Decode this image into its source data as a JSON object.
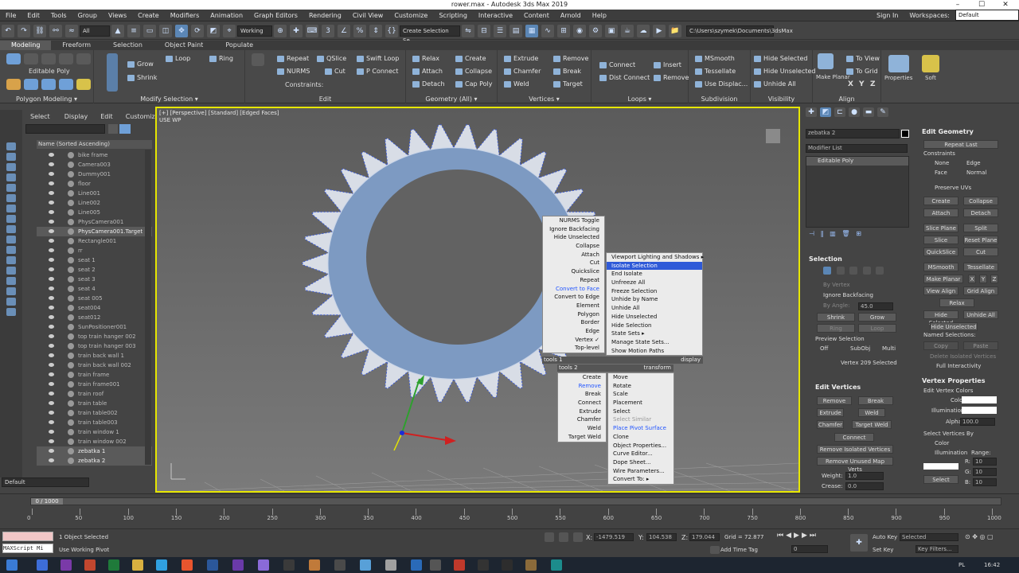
{
  "window": {
    "title": "rower.max - Autodesk 3ds Max 2019"
  },
  "menubar": [
    "File",
    "Edit",
    "Tools",
    "Group",
    "Views",
    "Create",
    "Modifiers",
    "Animation",
    "Graph Editors",
    "Rendering",
    "Civil View",
    "Customize",
    "Scripting",
    "Interactive",
    "Content",
    "Arnold",
    "Help"
  ],
  "account": {
    "sign_in": "Sign In",
    "workspaces_label": "Workspaces:",
    "workspace": "Default"
  },
  "maintoolbar": {
    "filter": "All",
    "working": "Working",
    "selection_set": "Create Selection Se",
    "path": "C:\\Users\\szymek\\Documents\\3dsMax"
  },
  "ribbon": {
    "tabs": [
      "Modeling",
      "Freeform",
      "Selection",
      "Object Paint",
      "Populate"
    ],
    "active_tab": "Modeling",
    "editable_poly_label": "Editable Poly",
    "groups": {
      "polygon_modeling": "Polygon Modeling ▾",
      "modify_selection": "Modify Selection ▾",
      "edit": "Edit",
      "geometry": "Geometry (All) ▾",
      "vertices": "Vertices ▾",
      "loops": "Loops ▾",
      "subdivision": "Subdivision",
      "visibility": "Visibility",
      "align": "Align"
    },
    "modsel": [
      "Grow",
      "Shrink",
      "Loop",
      "Ring"
    ],
    "edit_items": [
      "Repeat",
      "QSlice",
      "Swift Loop",
      "NURMS",
      "Cut",
      "P Connect",
      "Constraints:"
    ],
    "geometry_items": [
      "Relax",
      "Create",
      "Attach",
      "Collapse",
      "Detach",
      "Cap Poly"
    ],
    "vertices_items": [
      "Extrude",
      "Remove",
      "Chamfer",
      "Break",
      "Weld",
      "Target"
    ],
    "loops_items": [
      "Connect",
      "Insert",
      "Dist Connect",
      "Remove"
    ],
    "subdivision_items": [
      "MSmooth",
      "Tessellate",
      "Use Displac..."
    ],
    "visibility_items": [
      "Hide Selected",
      "Hide Unselected",
      "Unhide All"
    ],
    "align_items": [
      "Make Planar",
      "To View",
      "To Grid",
      "X",
      "Y",
      "Z"
    ],
    "properties": "Properties",
    "soft": "Soft"
  },
  "explorer": {
    "tabs": [
      "Select",
      "Display",
      "Edit",
      "Customize"
    ],
    "column": "Name (Sorted Ascending)",
    "items": [
      {
        "name": "bike frame",
        "dim": true
      },
      {
        "name": "Camera003",
        "dim": true
      },
      {
        "name": "Dummy001",
        "dim": true
      },
      {
        "name": "floor",
        "dim": true
      },
      {
        "name": "Line001",
        "dim": true
      },
      {
        "name": "Line002",
        "dim": true
      },
      {
        "name": "Line005",
        "dim": true
      },
      {
        "name": "PhysCamera001",
        "dim": true
      },
      {
        "name": "PhysCamera001.Target",
        "dim": false
      },
      {
        "name": "Rectangle001",
        "dim": true
      },
      {
        "name": "rr",
        "dim": true
      },
      {
        "name": "seat 1",
        "dim": true
      },
      {
        "name": "seat 2",
        "dim": true
      },
      {
        "name": "seat 3",
        "dim": true
      },
      {
        "name": "seat 4",
        "dim": true
      },
      {
        "name": "seat 005",
        "dim": true
      },
      {
        "name": "seat004",
        "dim": true
      },
      {
        "name": "seat012",
        "dim": true
      },
      {
        "name": "SunPositioner001",
        "dim": true
      },
      {
        "name": "top train hanger 002",
        "dim": true
      },
      {
        "name": "top train hanger 003",
        "dim": true
      },
      {
        "name": "train back wall 1",
        "dim": true
      },
      {
        "name": "train back wall 002",
        "dim": true
      },
      {
        "name": "train frame",
        "dim": true
      },
      {
        "name": "train frame001",
        "dim": true
      },
      {
        "name": "train roof",
        "dim": true
      },
      {
        "name": "train table",
        "dim": true
      },
      {
        "name": "train table002",
        "dim": true
      },
      {
        "name": "train table003",
        "dim": true
      },
      {
        "name": "train window 1",
        "dim": true
      },
      {
        "name": "train window 002",
        "dim": true
      },
      {
        "name": "zebatka 1",
        "dim": false
      },
      {
        "name": "zebatka 2",
        "dim": false
      }
    ],
    "layer": "Default"
  },
  "viewport": {
    "label": "[+] [Perspective] [Standard] [Edged Faces]",
    "sublabel": "USE WP"
  },
  "quad": {
    "left_top": [
      {
        "t": "NURMS Toggle"
      },
      {
        "t": "Ignore Backfacing"
      },
      {
        "t": "Hide Unselected"
      },
      {
        "t": "Collapse"
      },
      {
        "t": "Attach",
        "box": true
      },
      {
        "t": "Cut"
      },
      {
        "t": "Quickslice"
      },
      {
        "t": "Repeat"
      },
      {
        "t": "Convert to Face",
        "hl": true
      },
      {
        "t": "Convert to Edge"
      },
      {
        "t": "Element"
      },
      {
        "t": "Polygon"
      },
      {
        "t": "Border"
      },
      {
        "t": "Edge"
      },
      {
        "t": "Vertex ✓"
      },
      {
        "t": "Top-level"
      }
    ],
    "right_top": [
      {
        "t": "Viewport Lighting and Shadows ▸"
      },
      {
        "t": "Isolate Selection",
        "sel": true
      },
      {
        "t": "End Isolate"
      },
      {
        "t": "Unfreeze All"
      },
      {
        "t": "Freeze Selection"
      },
      {
        "t": "Unhide by Name"
      },
      {
        "t": "Unhide All"
      },
      {
        "t": "Hide Unselected"
      },
      {
        "t": "Hide Selection"
      },
      {
        "t": "State Sets ▸"
      },
      {
        "t": "Manage State Sets..."
      },
      {
        "t": "Show Motion Paths"
      }
    ],
    "bar_tools1": "tools 1",
    "bar_display": "display",
    "bar_tools2": "tools 2",
    "bar_transform": "transform",
    "left_bottom": [
      {
        "t": "Create"
      },
      {
        "t": "Remove",
        "hl": true
      },
      {
        "t": "Break"
      },
      {
        "t": "Connect"
      },
      {
        "t": "Extrude",
        "box": true
      },
      {
        "t": "Chamfer",
        "box": true
      },
      {
        "t": "Weld",
        "box": true
      },
      {
        "t": "Target Weld"
      }
    ],
    "right_bottom": [
      {
        "t": "Move"
      },
      {
        "t": "Rotate"
      },
      {
        "t": "Scale"
      },
      {
        "t": "Placement"
      },
      {
        "t": "Select"
      },
      {
        "t": "Select Similar",
        "dim": true
      },
      {
        "t": "Place Pivot Surface",
        "hl": true
      },
      {
        "t": "Clone"
      },
      {
        "t": "Object Properties..."
      },
      {
        "t": "Curve Editor..."
      },
      {
        "t": "Dope Sheet..."
      },
      {
        "t": "Wire Parameters..."
      },
      {
        "t": "Convert To: ▸"
      }
    ]
  },
  "command": {
    "object_name": "zebatka 2",
    "modifier_list": "Modifier List",
    "stack_item": "Editable Poly",
    "selection": {
      "title": "Selection",
      "by_vertex": "By Vertex",
      "ignore_backfacing": "Ignore Backfacing",
      "by_angle": "By Angle:",
      "angle": "45.0",
      "shrink": "Shrink",
      "grow": "Grow",
      "ring": "Ring",
      "loop": "Loop",
      "preview": "Preview Selection",
      "preview_opts": [
        "Off",
        "SubObj",
        "Multi"
      ],
      "status": "Vertex 209 Selected"
    },
    "edit_vertices": {
      "title": "Edit Vertices",
      "buttons": [
        "Remove",
        "Break",
        "Extrude",
        "Weld",
        "Chamfer",
        "Target Weld",
        "Connect",
        "Remove Isolated Vertices",
        "Remove Unused Map Verts"
      ],
      "weight_label": "Weight:",
      "weight": "1.0",
      "crease_label": "Crease:",
      "crease": "0.0"
    },
    "edit_geometry": {
      "title": "Edit Geometry",
      "repeat_last": "Repeat Last",
      "constraints": "Constraints",
      "constraint_opts": [
        "None",
        "Edge",
        "Face",
        "Normal"
      ],
      "preserve_uvs": "Preserve UVs",
      "buttons": [
        "Create",
        "Collapse",
        "Attach",
        "Detach",
        "Slice Plane",
        "Split",
        "Slice",
        "Reset Plane",
        "QuickSlice",
        "Cut",
        "MSmooth",
        "Tessellate",
        "Make Planar",
        "X",
        "Y",
        "Z",
        "View Align",
        "Grid Align",
        "Relax",
        "Hide Selected",
        "Unhide All",
        "Hide Unselected"
      ],
      "named_selections": "Named Selections:",
      "copy": "Copy",
      "paste": "Paste",
      "delete_isolated": "Delete Isolated Vertices",
      "full_interactivity": "Full Interactivity"
    },
    "vertex_properties": {
      "title": "Vertex Properties",
      "edit_colors": "Edit Vertex Colors",
      "color": "Color:",
      "illumination": "Illumination:",
      "alpha_label": "Alpha:",
      "alpha": "100.0",
      "select_by": "Select Vertices By",
      "opt_color": "Color",
      "opt_illum": "Illumination",
      "range": "Range:",
      "r": "R:",
      "g": "G:",
      "b": "B:",
      "rv": "10",
      "gv": "10",
      "bv": "10",
      "select": "Select"
    }
  },
  "timeline": {
    "frame": "0 / 1000",
    "ticks": [
      "0",
      "50",
      "100",
      "150",
      "200",
      "250",
      "300",
      "350",
      "400",
      "450",
      "500",
      "550",
      "600",
      "650",
      "700",
      "750",
      "800",
      "850",
      "900",
      "950",
      "1000"
    ]
  },
  "status": {
    "script": "MAXScript Mi",
    "selected": "1 Object Selected",
    "pivot": "Use Working Pivot",
    "x": "-1479.519",
    "y": "104.538",
    "z": "179.044",
    "grid": "Grid = 72.877",
    "add_time_tag": "Add Time Tag",
    "auto_key": "Auto Key",
    "set_key": "Set Key",
    "selected_dd": "Selected",
    "key_filters": "Key Filters...",
    "frame_box": "0"
  },
  "taskbar": {
    "lang": "PL",
    "time": "16:42"
  }
}
